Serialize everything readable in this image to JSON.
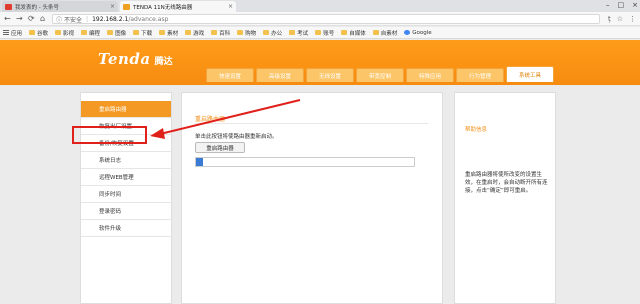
{
  "browser": {
    "tabs": [
      {
        "title": "我发表的 - 头条号",
        "favicon_color": "#e03c31"
      },
      {
        "title": "TENDA 11N无线路由器",
        "favicon_color": "#f0a020"
      }
    ],
    "address": {
      "security": "不安全",
      "host": "192.168.2.1",
      "path": "/advance.asp"
    },
    "bookmarks": [
      "应用",
      "谷歌",
      "影视",
      "编程",
      "图像",
      "下载",
      "素材",
      "游戏",
      "百科",
      "购物",
      "办公",
      "考试",
      "账号",
      "自媒体",
      "自素材",
      "Google"
    ]
  },
  "router": {
    "brand_en": "Tenda",
    "brand_cn": "腾达",
    "menu": [
      "快速设置",
      "高级设置",
      "无线设置",
      "带宽控制",
      "特殊应用",
      "行为管理",
      "系统工具"
    ],
    "active_menu_index": 6,
    "sidebar": [
      "重启路由器",
      "恢复出厂设置",
      "备份/恢复设置",
      "系统日志",
      "远程WEB管理",
      "同步时间",
      "登录密码",
      "软件升级"
    ],
    "active_sidebar_index": 0,
    "main": {
      "title": "重启路由器",
      "description": "单击此按钮将使路由器重新启动。",
      "button": "重启路由器",
      "progress": 0.03
    },
    "help": {
      "title": "帮助信息",
      "text": "重启路由器将使所改变的设置生效，在重启时，会自动断开所有连接，点击“确定”即可重启。"
    }
  },
  "annotation": {
    "color": "#e0201b"
  }
}
